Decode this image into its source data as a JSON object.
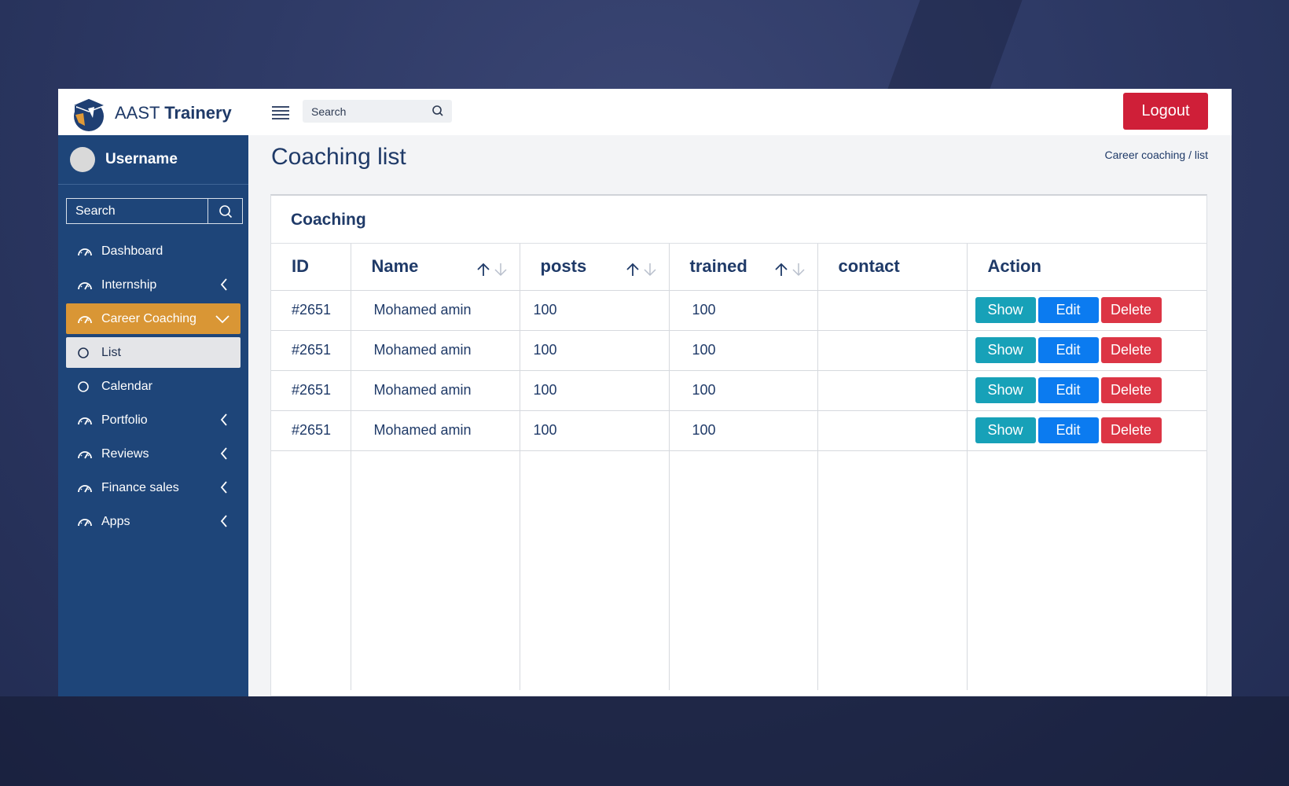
{
  "app": {
    "brand_prefix": "AAST",
    "brand_name": "Trainery",
    "logout_label": "Logout",
    "search_placeholder": "Search"
  },
  "sidebar": {
    "username": "Username",
    "search_placeholder": "Search",
    "items": [
      {
        "label": "Dashboard",
        "icon": "gauge-icon",
        "chevron": false,
        "state": "normal"
      },
      {
        "label": "Internship",
        "icon": "gauge-icon",
        "chevron": "left",
        "state": "normal"
      },
      {
        "label": "Career Coaching",
        "icon": "gauge-icon",
        "chevron": "down",
        "state": "active"
      },
      {
        "label": "List",
        "icon": "circle-icon",
        "chevron": false,
        "state": "sub-active"
      },
      {
        "label": "Calendar",
        "icon": "circle-icon",
        "chevron": false,
        "state": "normal"
      },
      {
        "label": "Portfolio",
        "icon": "gauge-icon",
        "chevron": "left",
        "state": "normal"
      },
      {
        "label": "Reviews",
        "icon": "gauge-icon",
        "chevron": "left",
        "state": "normal"
      },
      {
        "label": "Finance sales",
        "icon": "gauge-icon",
        "chevron": "left",
        "state": "normal"
      },
      {
        "label": "Apps",
        "icon": "gauge-icon",
        "chevron": "left",
        "state": "normal"
      }
    ]
  },
  "main": {
    "title": "Coaching list",
    "breadcrumb": "Career coaching / list",
    "card_title": "Coaching",
    "columns": [
      {
        "label": "ID",
        "sortable": false
      },
      {
        "label": "Name",
        "sortable": true
      },
      {
        "label": "posts",
        "sortable": true
      },
      {
        "label": "trained",
        "sortable": true
      },
      {
        "label": "contact",
        "sortable": false
      },
      {
        "label": "Action",
        "sortable": false
      }
    ],
    "rows": [
      {
        "id": "#2651",
        "name": "Mohamed amin",
        "posts": "100",
        "trained": "100",
        "contact": ""
      },
      {
        "id": "#2651",
        "name": "Mohamed amin",
        "posts": "100",
        "trained": "100",
        "contact": ""
      },
      {
        "id": "#2651",
        "name": "Mohamed amin",
        "posts": "100",
        "trained": "100",
        "contact": ""
      },
      {
        "id": "#2651",
        "name": "Mohamed amin",
        "posts": "100",
        "trained": "100",
        "contact": ""
      }
    ],
    "actions": {
      "show": "Show",
      "edit": "Edit",
      "delete": "Delete"
    }
  },
  "colors": {
    "sidebar": "#1e4579",
    "active_item": "#d99635",
    "logout": "#cf1f38",
    "show": "#17a1b8",
    "edit": "#0b7bf0",
    "delete": "#dc3545"
  }
}
